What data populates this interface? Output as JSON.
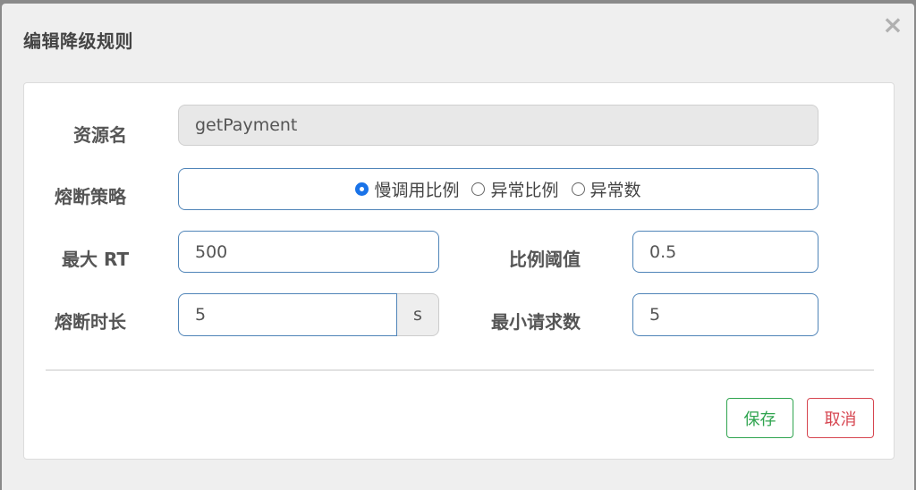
{
  "dialog": {
    "title": "编辑降级规则",
    "close_symbol": "×"
  },
  "form": {
    "resource": {
      "label": "资源名",
      "value": "getPayment"
    },
    "strategy": {
      "label": "熔断策略",
      "options": [
        {
          "label": "慢调用比例",
          "checked": true
        },
        {
          "label": "异常比例",
          "checked": false
        },
        {
          "label": "异常数",
          "checked": false
        }
      ]
    },
    "max_rt": {
      "label": "最大 RT",
      "value": "500"
    },
    "ratio_threshold": {
      "label": "比例阈值",
      "value": "0.5"
    },
    "break_duration": {
      "label": "熔断时长",
      "value": "5",
      "unit": "s"
    },
    "min_requests": {
      "label": "最小请求数",
      "value": "5"
    }
  },
  "buttons": {
    "save": "保存",
    "cancel": "取消"
  },
  "colors": {
    "input_border": "#4f84b8",
    "radio_checked": "#1a73e8",
    "save": "#2fa44f",
    "cancel": "#d64550"
  }
}
